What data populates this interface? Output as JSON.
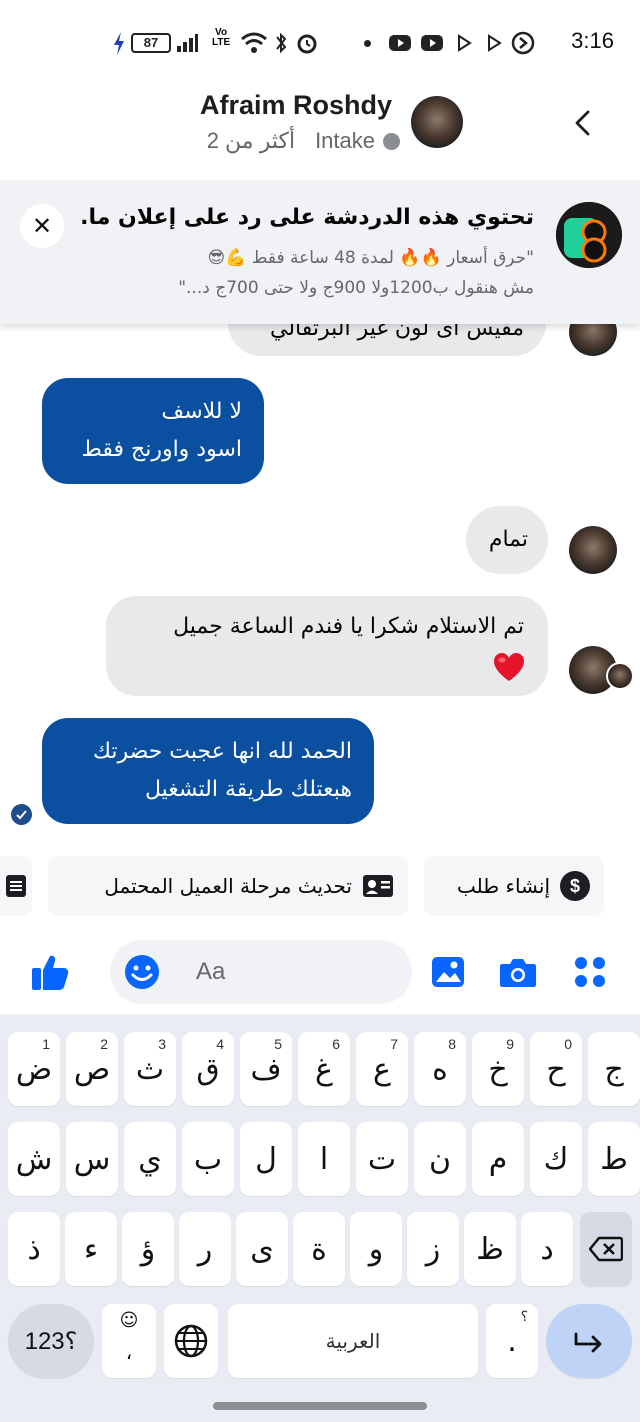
{
  "status_bar": {
    "time": "3:16",
    "battery": "87"
  },
  "header": {
    "contact_name": "Afraim Roshdy",
    "presence": "أكثر من 2",
    "label": "Intake"
  },
  "ad_banner": {
    "title": "تحتوي هذه الدردشة على رد على إعلان ما.",
    "line1": "\"حرق أسعار 🔥🔥 لمدة 48 ساعة فقط 💪😎",
    "line2": "مش هنقول ب1200ولا 900ج ولا حتى 700ج د...\"",
    "close_label": "✕"
  },
  "messages": [
    {
      "id": "partial",
      "direction": "in",
      "text": "مقيس اى لون غير البرتقالي"
    },
    {
      "id": "out1",
      "direction": "out",
      "lines": [
        "لا للاسف",
        "اسود واورنج فقط"
      ]
    },
    {
      "id": "in2",
      "direction": "in",
      "text": "تمام"
    },
    {
      "id": "in3",
      "direction": "in",
      "lines": [
        "تم الاستلام شكرا يا فندم الساعة جميل",
        "❤️"
      ]
    },
    {
      "id": "out4",
      "direction": "out",
      "lines": [
        "الحمد لله انها عجبت حضرتك",
        "هبعتلك طريقة التشغيل"
      ]
    }
  ],
  "quick_actions": [
    {
      "label": "إنشاء طلب",
      "icon": "dollar-icon"
    },
    {
      "label": "تحديث مرحلة العميل المحتمل",
      "icon": "contact-card-icon"
    },
    {
      "label": "",
      "icon": "list-icon"
    }
  ],
  "composer": {
    "placeholder": "Aa"
  },
  "keyboard": {
    "row1": [
      {
        "char": "ض",
        "num": "1"
      },
      {
        "char": "ص",
        "num": "2"
      },
      {
        "char": "ث",
        "num": "3"
      },
      {
        "char": "ق",
        "num": "4"
      },
      {
        "char": "ف",
        "num": "5"
      },
      {
        "char": "غ",
        "num": "6"
      },
      {
        "char": "ع",
        "num": "7"
      },
      {
        "char": "ه",
        "num": "8"
      },
      {
        "char": "خ",
        "num": "9"
      },
      {
        "char": "ح",
        "num": "0"
      },
      {
        "char": "ج",
        "num": ""
      }
    ],
    "row2": [
      "ش",
      "س",
      "ي",
      "ب",
      "ل",
      "ا",
      "ت",
      "ن",
      "م",
      "ك",
      "ط"
    ],
    "row3": [
      "ذ",
      "ء",
      "ؤ",
      "ر",
      "ى",
      "ة",
      "و",
      "ز",
      "ظ",
      "د"
    ],
    "sym_label": "؟123",
    "emoji_sub": "،",
    "space_label": "العربية",
    "period": ".",
    "period_sup": "؟"
  },
  "colors": {
    "outgoing_bubble": "#0a4fa0",
    "incoming_bubble": "#e9e9eb",
    "messenger_blue": "#0866ff",
    "keyboard_bg": "#e9ecf2"
  }
}
